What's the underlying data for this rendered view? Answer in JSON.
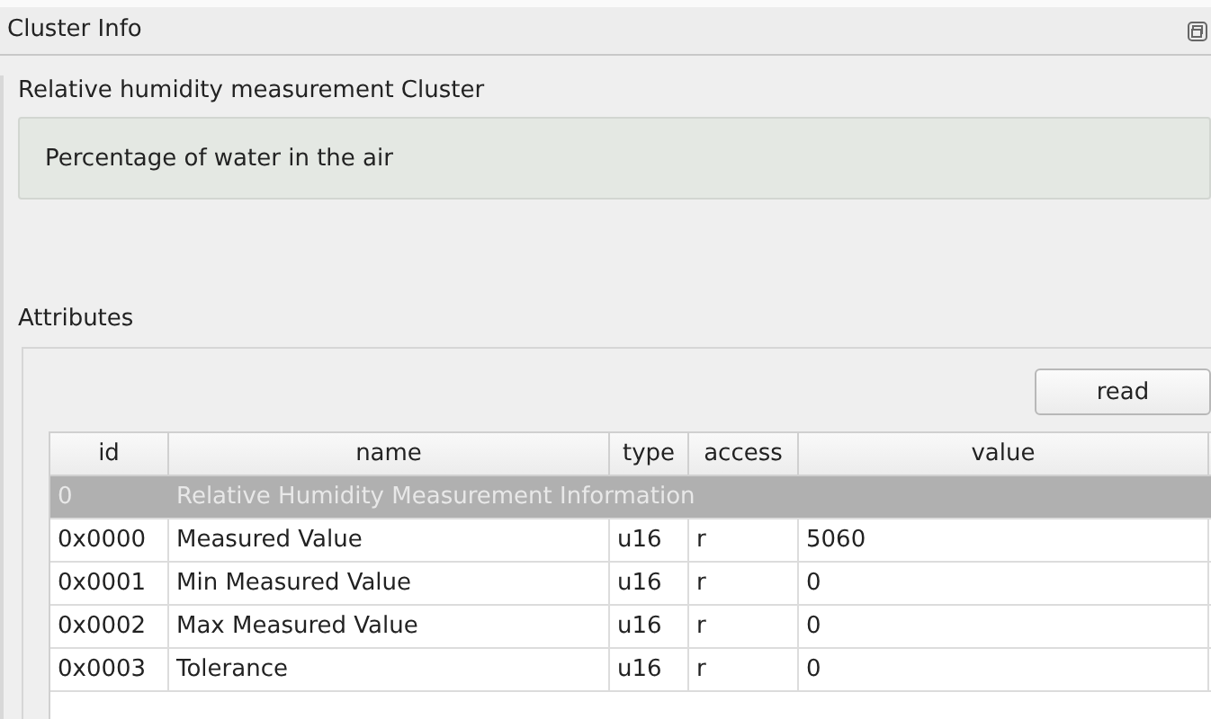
{
  "window": {
    "title": "Cluster Info"
  },
  "cluster": {
    "name": "Relative humidity measurement Cluster",
    "description": "Percentage of water in the air"
  },
  "attributes": {
    "label": "Attributes",
    "read_button": "read",
    "table": {
      "columns": [
        "id",
        "name",
        "type",
        "access",
        "value"
      ],
      "rows": [
        {
          "kind": "group",
          "id": "0",
          "name": "Relative Humidity Measurement Information"
        },
        {
          "kind": "attribute",
          "id": "0x0000",
          "name": "Measured Value",
          "type": "u16",
          "access": "r",
          "value": "5060"
        },
        {
          "kind": "attribute",
          "id": "0x0001",
          "name": "Min Measured Value",
          "type": "u16",
          "access": "r",
          "value": "0"
        },
        {
          "kind": "attribute",
          "id": "0x0002",
          "name": "Max Measured Value",
          "type": "u16",
          "access": "r",
          "value": "0"
        },
        {
          "kind": "attribute",
          "id": "0x0003",
          "name": "Tolerance",
          "type": "u16",
          "access": "r",
          "value": "0"
        }
      ]
    }
  }
}
